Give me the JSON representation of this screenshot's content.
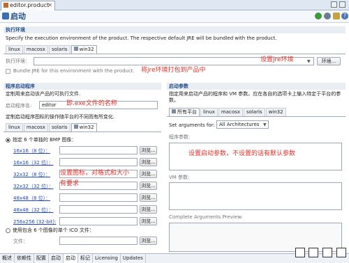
{
  "editor_tab": {
    "title": "editor.product"
  },
  "title": "启动",
  "exec_env": {
    "heading": "执行环境",
    "description": "Specify the execution environment of the product. The respective default JRE will be bundled with the product.",
    "tabs": [
      "linux",
      "macosx",
      "solaris",
      "win32"
    ],
    "selected_tab": "win32",
    "env_label": "执行环境：",
    "env_button": "环境...",
    "bundle_label": "Bundle JRE for this environment with the product.",
    "annotation_env": "设置jre环境",
    "annotation_bundle": "将jre环境打包到产品中"
  },
  "launcher": {
    "heading": "程序启动程序",
    "description": "定制用来启动该产品的可执行文件.",
    "name_label": "启动程序名:",
    "name_value": "editor",
    "annotation_name": "即.exe文件的名称",
    "icon_description": "定制启动程序图标的操作随平台的不同而有所变化.",
    "tabs": [
      "linux",
      "macosx",
      "solaris",
      "win32"
    ],
    "selected_tab": "win32",
    "bmp_radio_label": "指定 6 个单独的 BMP 图像：",
    "bmp_items": [
      "16x16（8 位）：",
      "16x16（32 位）：",
      "32x32（8 位）：",
      "32x32（32 位）：",
      "48x48（8 位）：",
      "48x48（32 位）：",
      "256x256 (32-bit):"
    ],
    "browse_label": "浏览...",
    "annotation_icon_line1": "设置图标，对格式和大小",
    "annotation_icon_line2": "有要求",
    "ico_radio_label": "使用包含 6 个图像的单个 ICO 文件：",
    "file_label": "文件："
  },
  "launch_args": {
    "heading": "启动参数",
    "description": "指定用来启动产品的程序和 VM 参数。应在各自的选项卡上输入特定于平台的参数。",
    "tabs": [
      "所有平台",
      "linux",
      "macosx",
      "solaris",
      "win32"
    ],
    "selected_tab": "所有平台",
    "set_args_label": "Set arguments for:",
    "set_args_value": "All Architectures",
    "program_args_label": "程序参数:",
    "annotation_args": "设置启动参数，不设置的话有默认参数",
    "vm_args_label": "VM 参数:",
    "complete_label": "Complete Arguments Preview:"
  },
  "bottom_tabs": [
    "概述",
    "依赖性",
    "配置",
    "启动",
    "启动",
    "标记",
    "Licensing",
    "Updates"
  ],
  "selected_bottom_tab": "启动",
  "colors": {
    "annotation": "#e0312b",
    "heading": "#274f8a",
    "link": "#2248b8"
  }
}
